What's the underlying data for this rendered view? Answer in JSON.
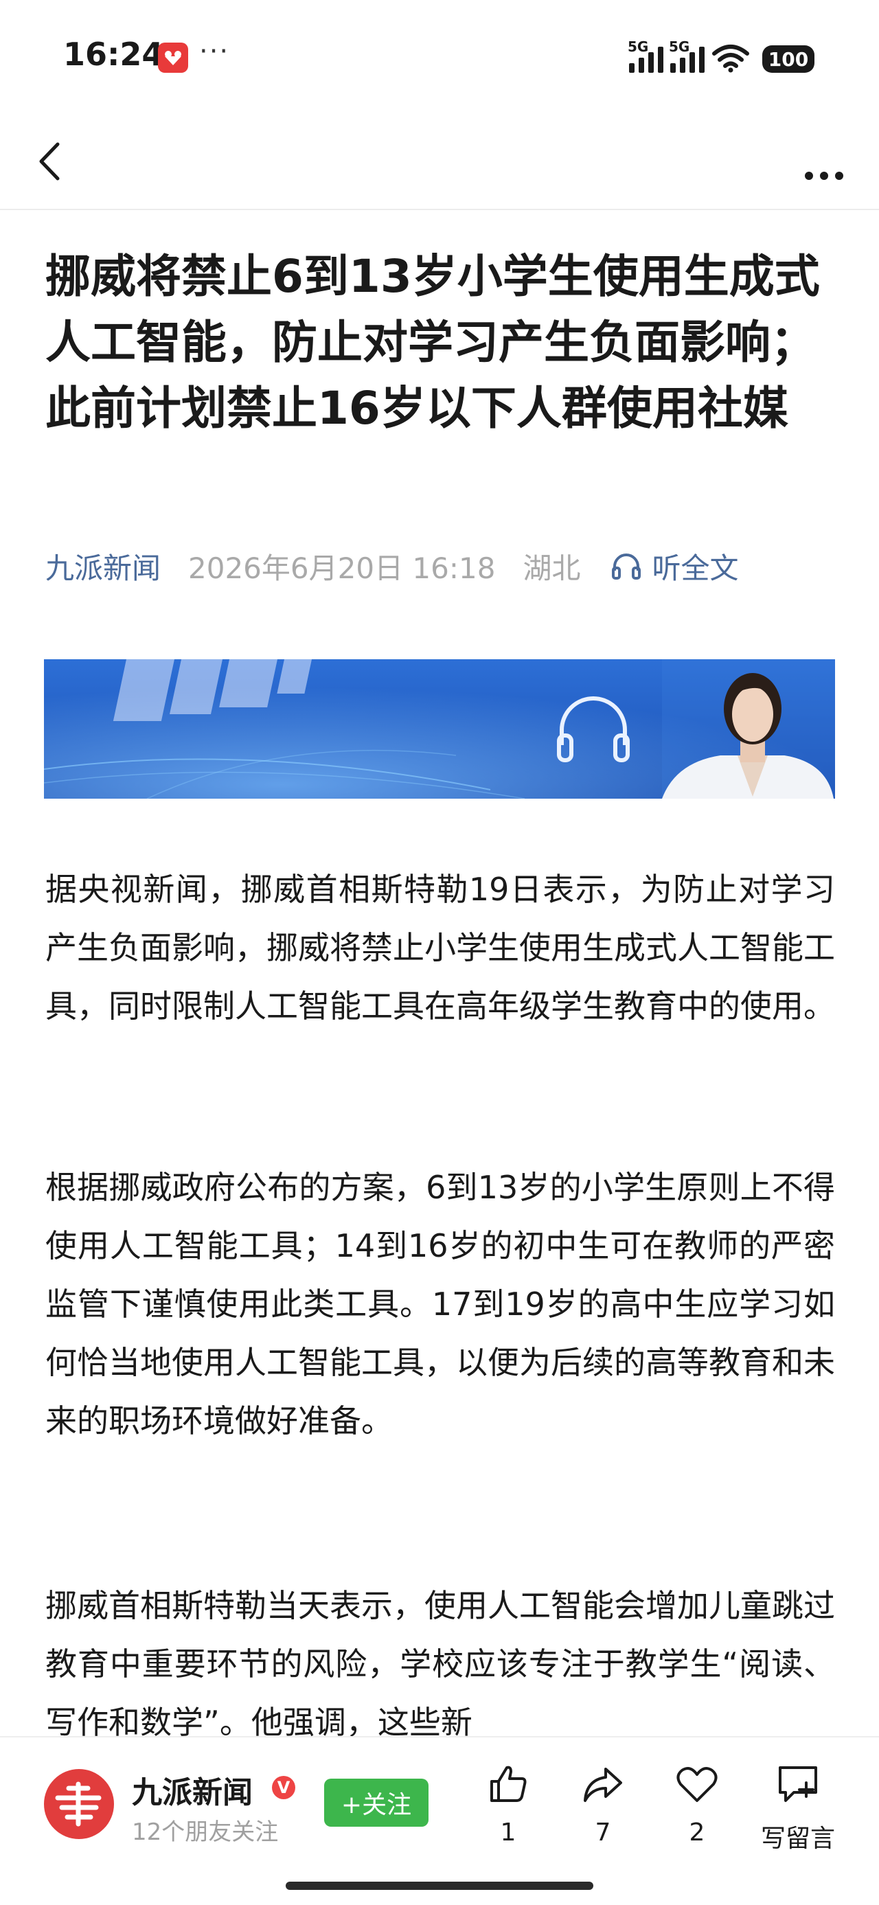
{
  "status_bar": {
    "time": "16:24",
    "dots": "···",
    "signal1_label": "5G",
    "signal2_label": "5G",
    "battery": "100"
  },
  "nav": {
    "back_icon": "chevron-left-icon",
    "more_icon": "more-horizontal-icon"
  },
  "article": {
    "title": "挪威将禁止6到13岁小学生使用生成式人工智能，防止对学习产生负面影响；此前计划禁止16岁以下人群使用社媒",
    "source": "九派新闻",
    "date": "2026年6月20日 16:18",
    "region": "湖北",
    "listen_label": "听全文",
    "paragraphs": [
      "据央视新闻，挪威首相斯特勒19日表示，为防止对学习产生负面影响，挪威将禁止小学生使用生成式人工智能工具，同时限制人工智能工具在高年级学生教育中的使用。",
      "根据挪威政府公布的方案，6到13岁的小学生原则上不得使用人工智能工具；14到16岁的初中生可在教师的严密监管下谨慎使用此类工具。17到19岁的高中生应学习如何恰当地使用人工智能工具，以便为后续的高等教育和未来的职场环境做好准备。",
      "挪威首相斯特勒当天表示，使用人工智能会增加儿童跳过教育中重要环节的风险，学校应该专注于教学生“阅读、写作和数学”。他强调，这些新"
    ]
  },
  "bottom_bar": {
    "publisher_name": "九派新闻",
    "verified_badge": "V",
    "followers": "12个朋友关注",
    "follow_label": "+关注",
    "like_count": "1",
    "share_count": "7",
    "favorite_count": "2",
    "comment_label": "写留言"
  },
  "colors": {
    "source_blue": "#4a6a9a",
    "meta_gray": "#a9a9a9",
    "follow_green": "#3db64c",
    "brand_red": "#e13d3d"
  }
}
